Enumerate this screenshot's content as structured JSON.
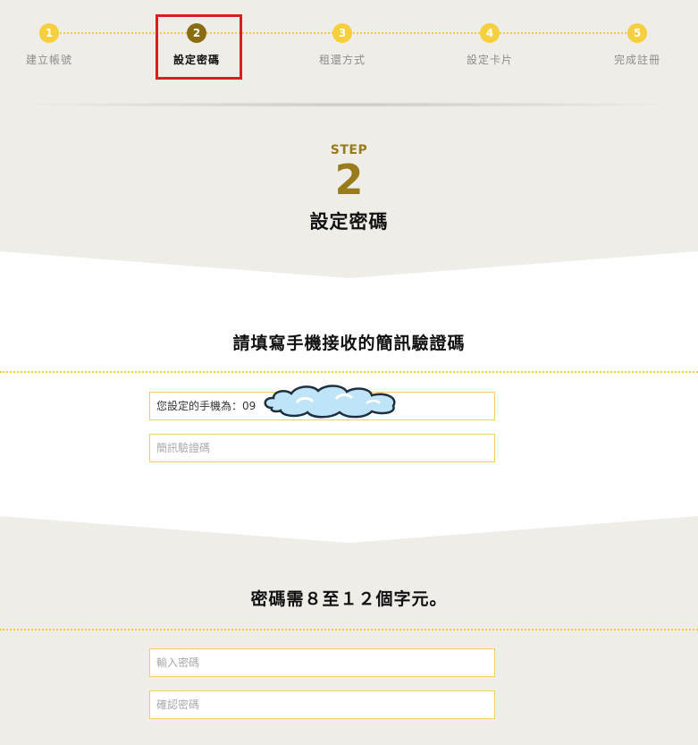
{
  "stepper": {
    "steps": [
      {
        "num": "1",
        "label": "建立帳號"
      },
      {
        "num": "2",
        "label": "設定密碼"
      },
      {
        "num": "3",
        "label": "租還方式"
      },
      {
        "num": "4",
        "label": "設定卡片"
      },
      {
        "num": "5",
        "label": "完成註冊"
      }
    ],
    "active_index": 2
  },
  "header": {
    "step_word": "STEP",
    "step_number": "2",
    "title": "設定密碼"
  },
  "sms_section": {
    "title": "請填寫手機接收的簡訊驗證碼",
    "phone_text": "您設定的手機為：09",
    "code_placeholder": "簡訊驗證碼"
  },
  "password_section": {
    "title": "密碼需８至１２個字元。",
    "password_placeholder": "輸入密碼",
    "confirm_placeholder": "確認密碼"
  },
  "colors": {
    "accent": "#f5cf3d",
    "active_step": "#8a6d12",
    "step_text": "#9a7b1c",
    "highlight_box": "#d81e1e",
    "background": "#efede8"
  }
}
